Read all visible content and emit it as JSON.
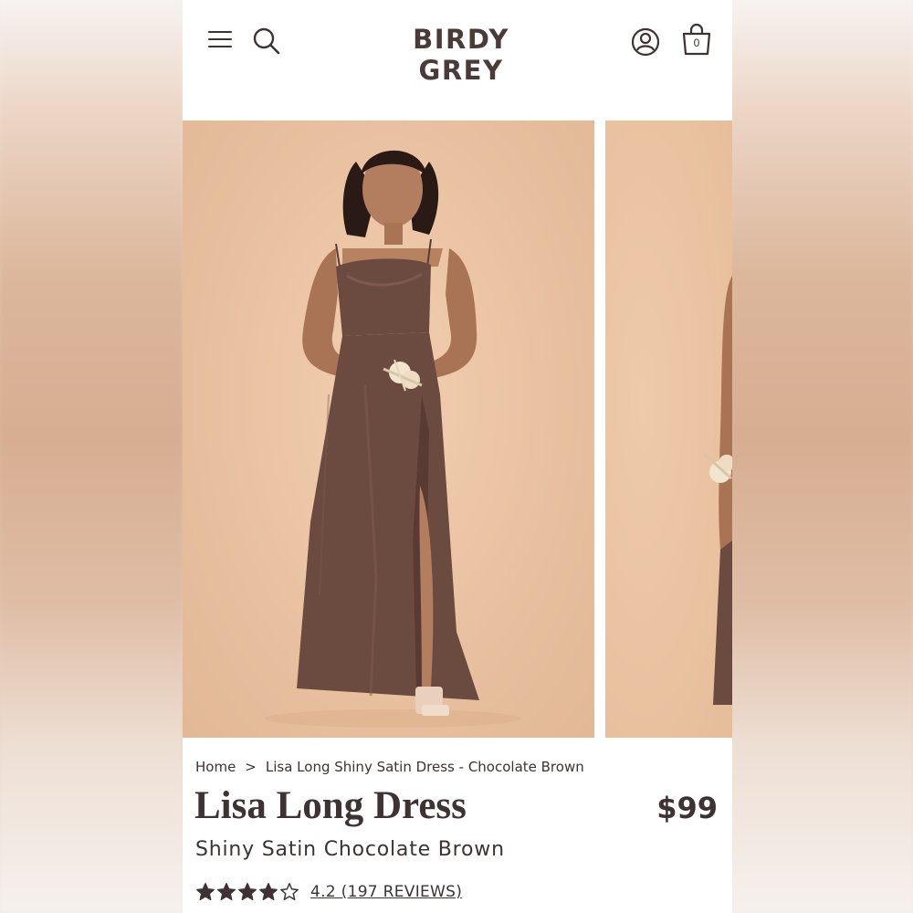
{
  "header": {
    "logo": "BIRDY GREY",
    "cart_count": "0"
  },
  "icons": {
    "menu": "hamburger-menu-icon",
    "search": "search-icon",
    "account": "account-icon",
    "bag": "shopping-bag-icon",
    "star": "star-icon"
  },
  "breadcrumb": {
    "home": "Home",
    "separator": ">",
    "current": "Lisa Long Shiny Satin Dress - Chocolate Brown"
  },
  "product": {
    "title": "Lisa Long Dress",
    "price": "$99",
    "subtitle": "Shiny Satin Chocolate Brown",
    "rating": 4.2,
    "rating_max": 5,
    "reviews_label": "4.2 (197 REVIEWS)"
  },
  "colors": {
    "text": "#3e3232",
    "backdrop": "#e8c09f",
    "dress": "#6b4a40"
  }
}
